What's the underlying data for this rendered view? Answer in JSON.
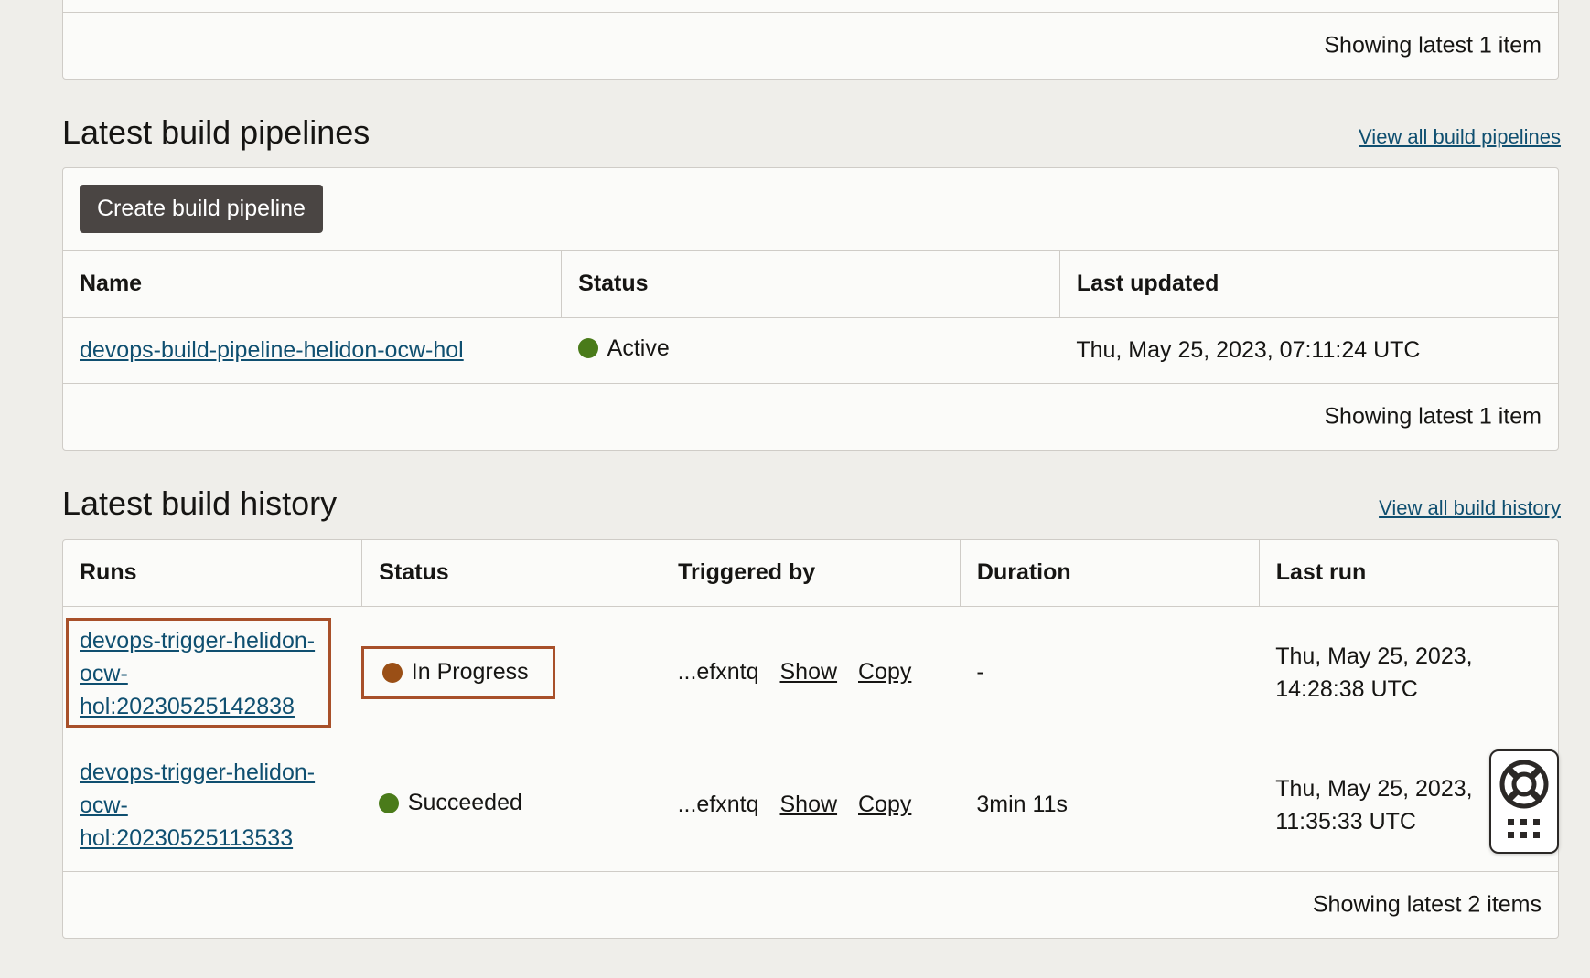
{
  "top_panel": {
    "footer": "Showing latest 1 item"
  },
  "build_pipelines": {
    "title": "Latest build pipelines",
    "view_all": "View all build pipelines",
    "create_button": "Create build pipeline",
    "columns": [
      "Name",
      "Status",
      "Last updated"
    ],
    "rows": [
      {
        "name": "devops-build-pipeline-helidon-ocw-hol",
        "status": "Active",
        "last_updated": "Thu, May 25, 2023, 07:11:24 UTC"
      }
    ],
    "footer": "Showing latest 1 item"
  },
  "build_history": {
    "title": "Latest build history",
    "view_all": "View all build history",
    "columns": [
      "Runs",
      "Status",
      "Triggered by",
      "Duration",
      "Last run"
    ],
    "rows": [
      {
        "run_line1": "devops-trigger-helidon-",
        "run_line2": "ocw-",
        "run_line3": "hol:20230525142838",
        "status": "In Progress",
        "triggered_by": "...efxntq",
        "show": "Show",
        "copy": "Copy",
        "duration": "-",
        "last_run_line1": "Thu, May 25, 2023,",
        "last_run_line2": "14:28:38 UTC"
      },
      {
        "run_line1": "devops-trigger-helidon-",
        "run_line2": "ocw-",
        "run_line3": "hol:20230525113533",
        "status": "Succeeded",
        "triggered_by": "...efxntq",
        "show": "Show",
        "copy": "Copy",
        "duration": "3min 11s",
        "last_run_line1": "Thu, May 25, 2023,",
        "last_run_line2": "11:35:33 UTC"
      }
    ],
    "footer": "Showing latest 2 items"
  },
  "colors": {
    "active": "#4a7b1a",
    "in_progress": "#9a4f16",
    "link": "#0f4f70",
    "highlight": "#a8502a"
  },
  "icons": {
    "help": "life-ring-icon",
    "apps": "grid-dots-icon"
  }
}
